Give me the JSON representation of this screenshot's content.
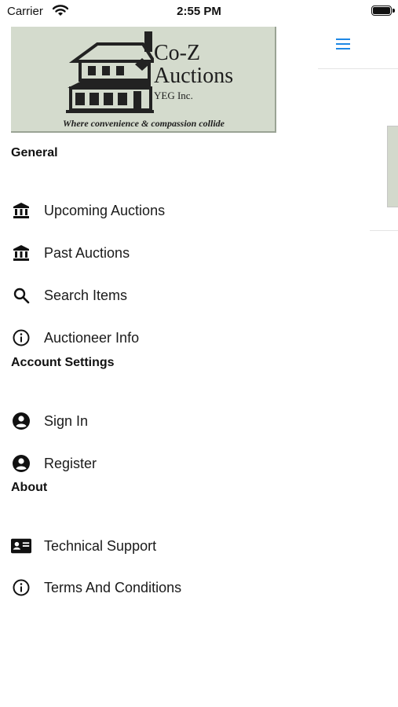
{
  "status_bar": {
    "carrier": "Carrier",
    "time": "2:55 PM"
  },
  "logo": {
    "brand_line1": "Co-Z",
    "brand_line2": "Auctions",
    "brand_line3": "YEG Inc.",
    "tagline": "Where convenience & compassion collide"
  },
  "sections": {
    "general": {
      "title": "General",
      "items": [
        {
          "label": "Upcoming Auctions",
          "icon": "bank-icon"
        },
        {
          "label": "Past Auctions",
          "icon": "bank-icon"
        },
        {
          "label": "Search Items",
          "icon": "search-icon"
        },
        {
          "label": "Auctioneer Info",
          "icon": "info-icon"
        }
      ]
    },
    "account": {
      "title": "Account Settings",
      "items": [
        {
          "label": "Sign In",
          "icon": "account-circle-icon"
        },
        {
          "label": "Register",
          "icon": "account-circle-icon"
        }
      ]
    },
    "about": {
      "title": "About",
      "items": [
        {
          "label": "Technical Support",
          "icon": "contact-card-icon"
        },
        {
          "label": "Terms And Conditions",
          "icon": "info-icon"
        }
      ]
    }
  },
  "colors": {
    "accent": "#1e88e5",
    "logo_background": "#d4dbcd"
  }
}
